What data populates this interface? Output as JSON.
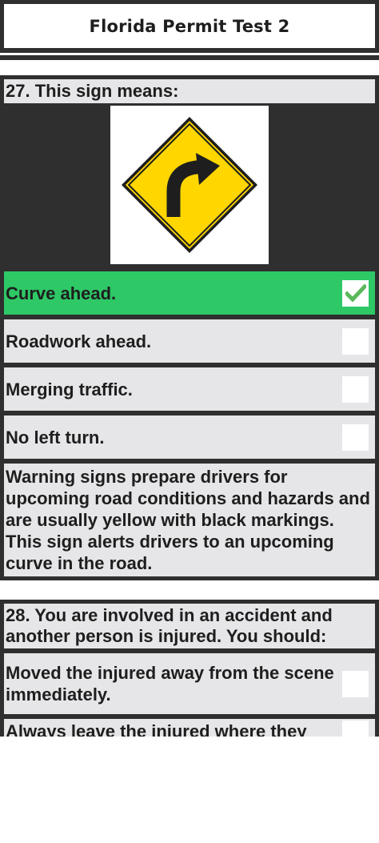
{
  "header": {
    "title": "Florida Permit Test 2"
  },
  "questions": [
    {
      "question": "27. This sign means:",
      "sign_icon": "curve-right-warning-sign",
      "options": [
        {
          "label": "Curve ahead.",
          "selected": true,
          "correct": true
        },
        {
          "label": "Roadwork ahead.",
          "selected": false
        },
        {
          "label": "Merging traffic.",
          "selected": false
        },
        {
          "label": "No left turn.",
          "selected": false
        }
      ],
      "explanation": "Warning signs prepare drivers for upcoming road conditions and hazards and are usually yellow with black markings. This sign alerts drivers to an upcoming curve in the road."
    },
    {
      "question": "28. You are involved in an accident and another person is injured. You should:",
      "options": [
        {
          "label": "Moved the injured away from the scene immediately.",
          "selected": false
        },
        {
          "label": "Always leave the injured where they",
          "selected": false
        }
      ]
    }
  ],
  "colors": {
    "frame": "#2f2f2f",
    "panel": "#e6e6e8",
    "correct": "#2ec866",
    "sign_yellow": "#ffd600"
  }
}
